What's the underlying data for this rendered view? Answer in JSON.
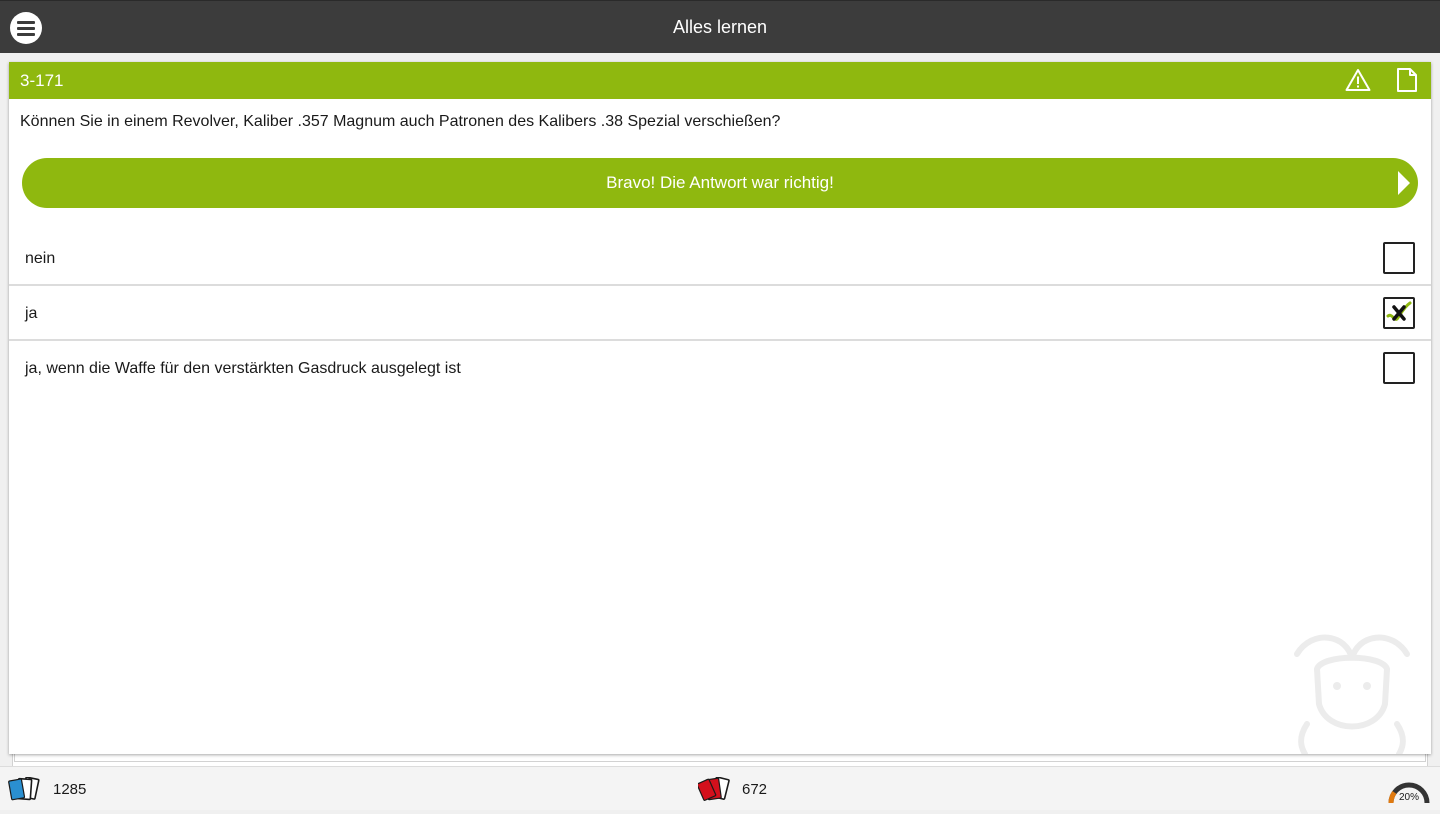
{
  "header": {
    "title": "Alles lernen",
    "menu_icon": "hamburger-menu-icon"
  },
  "card": {
    "question_number": "3-171",
    "question": "Können Sie in einem Revolver, Kaliber .357 Magnum auch Patronen des Kalibers .38 Spezial verschießen?",
    "feedback": "Bravo! Die Antwort war richtig!",
    "header_icons": [
      "warning-icon",
      "note-icon"
    ],
    "answers": [
      {
        "label": "nein",
        "checked": false
      },
      {
        "label": "ja",
        "checked": true
      },
      {
        "label": "ja, wenn die Waffe für den verstärkten Gasdruck ausgelegt ist",
        "checked": false
      }
    ]
  },
  "footer": {
    "cards_total": "1285",
    "cards_wrong": "672",
    "progress_label": "20%",
    "progress": 0.2
  },
  "colors": {
    "accent": "#8fb80f",
    "topbar": "#3c3c3c",
    "wrong_cards": "#d3101c",
    "total_cards": "#2a8fd0",
    "gauge": "#e07a10"
  }
}
